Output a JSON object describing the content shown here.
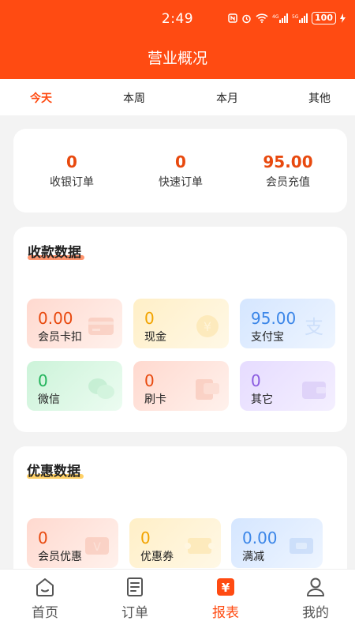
{
  "status_bar": {
    "time": "2:49",
    "battery": "100"
  },
  "header": {
    "title": "营业概况"
  },
  "tabs": [
    {
      "label": "今天",
      "active": true
    },
    {
      "label": "本周",
      "active": false
    },
    {
      "label": "本月",
      "active": false
    },
    {
      "label": "其他",
      "active": false
    }
  ],
  "summary": [
    {
      "value": "0",
      "label": "收银订单"
    },
    {
      "value": "0",
      "label": "快速订单"
    },
    {
      "value": "95.00",
      "label": "会员充值"
    }
  ],
  "payments": {
    "title": "收款数据",
    "tiles": [
      {
        "value": "0.00",
        "label": "会员卡扣",
        "icon": "card-icon"
      },
      {
        "value": "0",
        "label": "现金",
        "icon": "coin-icon"
      },
      {
        "value": "95.00",
        "label": "支付宝",
        "icon": "alipay-icon"
      },
      {
        "value": "0",
        "label": "微信",
        "icon": "wechat-icon"
      },
      {
        "value": "0",
        "label": "刷卡",
        "icon": "swipe-card-icon"
      },
      {
        "value": "0",
        "label": "其它",
        "icon": "wallet-icon"
      }
    ]
  },
  "discounts": {
    "title": "优惠数据",
    "tiles": [
      {
        "value": "0",
        "label": "会员优惠",
        "icon": "member-discount-icon"
      },
      {
        "value": "0",
        "label": "优惠券",
        "icon": "coupon-icon"
      },
      {
        "value": "0.00",
        "label": "满减",
        "icon": "ticket-icon"
      }
    ]
  },
  "tabbar": [
    {
      "label": "首页",
      "icon": "home-icon",
      "active": false
    },
    {
      "label": "订单",
      "icon": "order-icon",
      "active": false
    },
    {
      "label": "报表",
      "icon": "report-icon",
      "active": true
    },
    {
      "label": "我的",
      "icon": "profile-icon",
      "active": false
    }
  ],
  "colors": {
    "primary": "#ff4b12",
    "background": "#f3f3f3"
  }
}
